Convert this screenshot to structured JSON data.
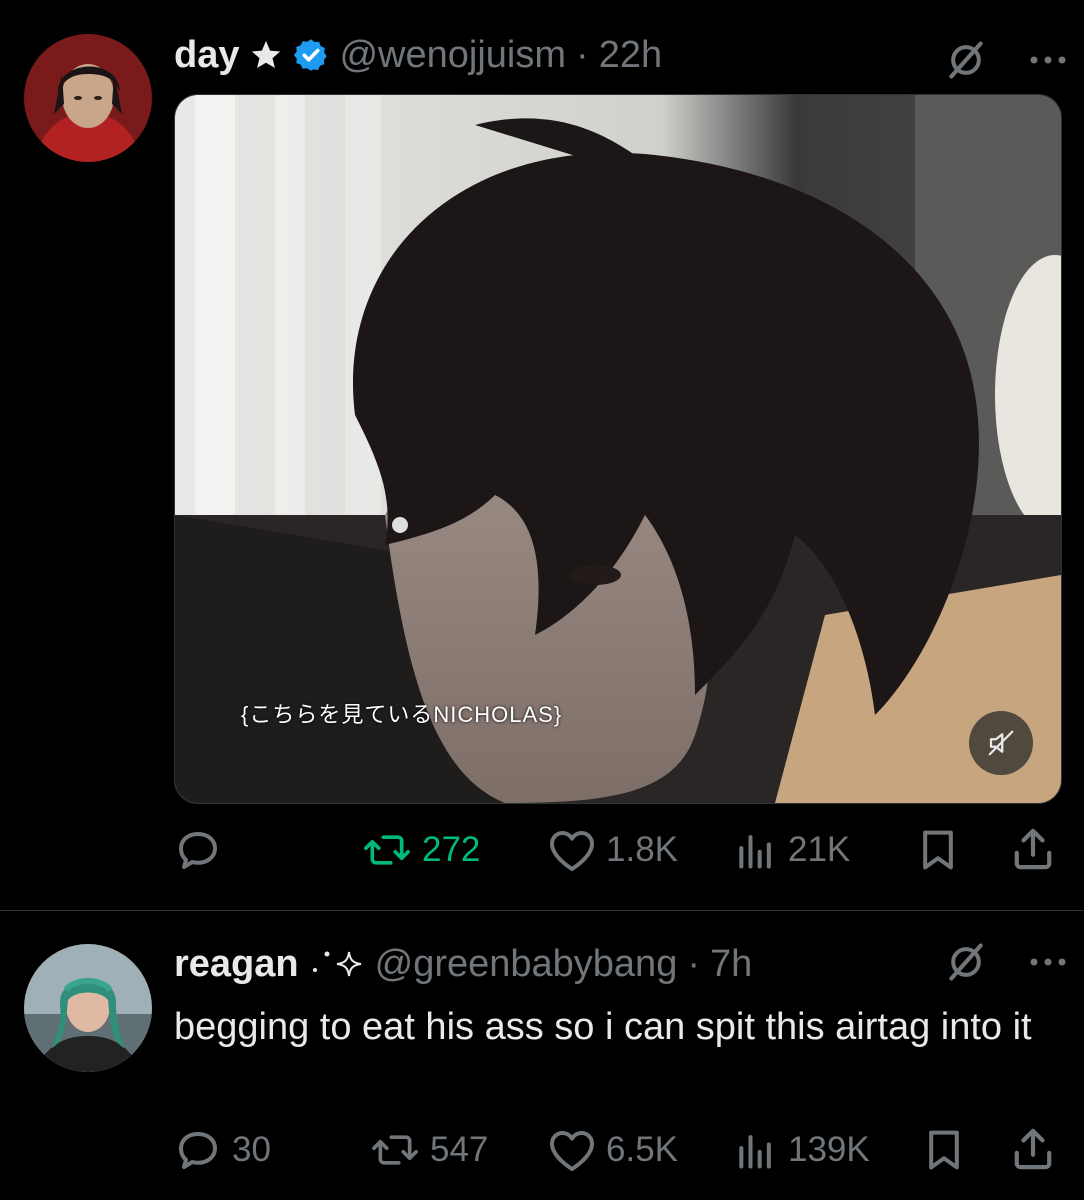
{
  "tweet1": {
    "display_name": "day",
    "handle": "@wenojjuism",
    "separator": "·",
    "time": "22h",
    "media_caption": "{こちらを見ているNICHOLAS}",
    "retweets": "272",
    "likes": "1.8K",
    "views": "21K",
    "retweet_color": "#00ba7c"
  },
  "tweet2": {
    "display_name": "reagan",
    "handle": "@greenbabybang",
    "separator": "·",
    "time": "7h",
    "text": "begging to eat his ass so i can spit this airtag into it",
    "replies": "30",
    "retweets": "547",
    "likes": "6.5K",
    "views": "139K"
  },
  "icons": {
    "verified": "verified-badge-icon",
    "star": "star-icon",
    "sparkle": "sparkle-icon",
    "grok": "grok-icon",
    "more": "more-icon",
    "reply": "reply-icon",
    "retweet": "retweet-icon",
    "like": "heart-icon",
    "views": "views-icon",
    "bookmark": "bookmark-icon",
    "share": "share-icon",
    "mute": "muted-speaker-icon"
  },
  "colors": {
    "accent": "#1d9bf0",
    "muted": "#71767b",
    "text": "#e7e9ea"
  }
}
